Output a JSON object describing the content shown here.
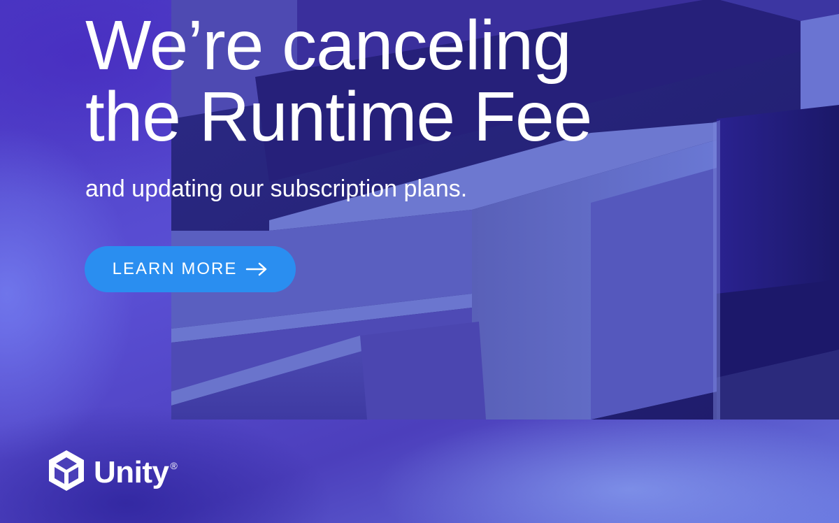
{
  "hero": {
    "headline_line1": "We’re canceling",
    "headline_line2": "the Runtime Fee",
    "subheadline": "and updating our subscription plans.",
    "cta_label": "LEARN MORE",
    "cta_icon": "arrow-right-icon"
  },
  "brand": {
    "name": "Unity",
    "registered_mark": "®",
    "logo_icon": "unity-cube-icon"
  },
  "colors": {
    "background": "#4a3fb8",
    "cta": "#2a8ef0",
    "text": "#ffffff"
  }
}
